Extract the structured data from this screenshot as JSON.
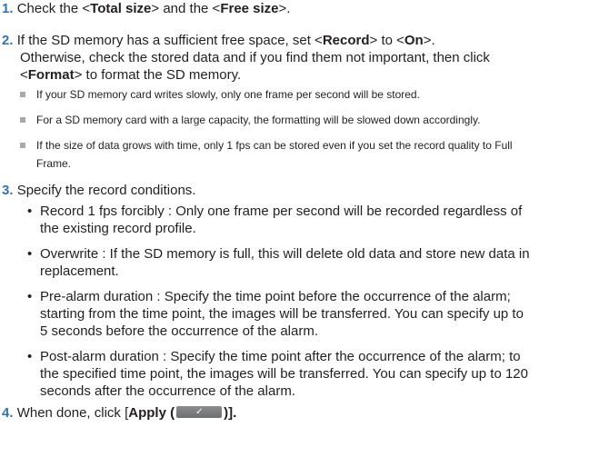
{
  "steps": [
    {
      "num": "1.",
      "parts": [
        "Check the <",
        "Total size",
        "> and the <",
        "Free size",
        ">."
      ]
    },
    {
      "num": "2.",
      "line1": [
        "If the SD memory has a sufficient free space, set <",
        "Record",
        "> to <",
        "On",
        ">."
      ],
      "line2": "Otherwise, check the stored data and if you find them not important, then click",
      "line3": [
        "<",
        "Format",
        "> to format the SD memory."
      ]
    },
    {
      "num": "3.",
      "text": "Specify the record conditions."
    },
    {
      "num": "4.",
      "parts": [
        "When done, click [",
        "Apply (",
        ")]."
      ]
    }
  ],
  "notes": [
    [
      "If your SD memory card writes slowly, only one frame per second will be stored."
    ],
    [
      "For a SD memory card with a large capacity, the formatting will be slowed down accordingly."
    ],
    [
      "If the size of data grows with time, only 1 fps can be stored even if you set the record quality to Full",
      "Frame."
    ]
  ],
  "bullets": [
    [
      "Record 1 fps forcibly : Only one frame per second will be recorded regardless of",
      "the existing record profile."
    ],
    [
      "Overwrite : If the SD memory is full, this will delete old data and store new data in",
      "replacement."
    ],
    [
      "Pre-alarm duration : Specify the time point before the occurrence of the alarm;",
      "starting from the time point, the images will be transferred. You can specify up to",
      "5 seconds before the occurrence of the alarm."
    ],
    [
      "Post-alarm duration : Specify the time point after the occurrence of the alarm; to",
      "the specified time point, the images will be transferred. You can specify up to 120",
      "seconds after the occurrence of the alarm."
    ]
  ],
  "bullet_glyph": "•",
  "apply_icon": "checkmark-icon",
  "apply_check_glyph": "✓",
  "colors": {
    "step_number": "#2f73b8",
    "note_marker": "#a7a9ac",
    "text": "#231f20",
    "button": "#6d6e70"
  }
}
